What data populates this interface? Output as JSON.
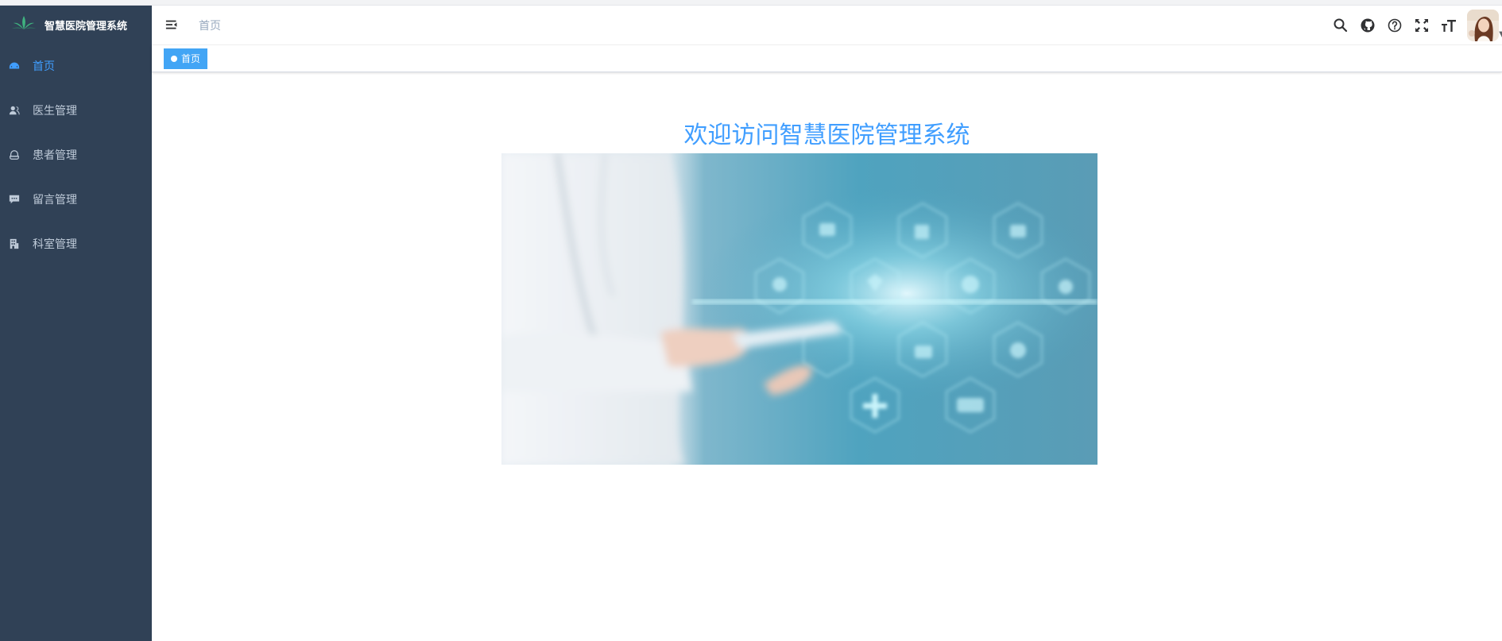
{
  "app": {
    "title": "智慧医院管理系统",
    "logo_icon": "leaf-logo-icon"
  },
  "sidebar": {
    "items": [
      {
        "label": "首页",
        "icon": "dashboard-icon",
        "active": true
      },
      {
        "label": "医生管理",
        "icon": "user-icon",
        "active": false
      },
      {
        "label": "患者管理",
        "icon": "peoples-icon",
        "active": false
      },
      {
        "label": "留言管理",
        "icon": "message-icon",
        "active": false
      },
      {
        "label": "科室管理",
        "icon": "building-icon",
        "active": false
      }
    ]
  },
  "navbar": {
    "breadcrumb": "首页",
    "tools": [
      "search-icon",
      "github-icon",
      "question-icon",
      "fullscreen-icon",
      "text-size-icon"
    ]
  },
  "tags_view": {
    "tags": [
      {
        "label": "首页",
        "active": true
      }
    ]
  },
  "main": {
    "welcome": "欢迎访问智慧医院管理系统"
  },
  "colors": {
    "sidebar_bg": "#304156",
    "accent": "#409eff",
    "tag_active": "#42a5f5"
  }
}
